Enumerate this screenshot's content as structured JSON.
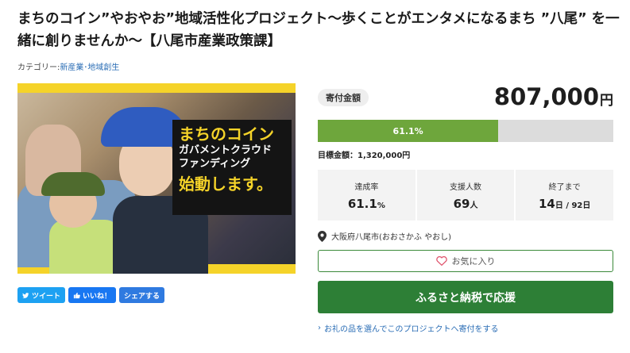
{
  "project": {
    "title": "まちのコイン”やおやお”地域活性化プロジェクト〜歩くことがエンタメになるまち ”八尾” を一緒に創りませんか〜【八尾市産業政策課】",
    "category_label": "カテゴリー:",
    "category_value": "新産業･地域創生"
  },
  "hero": {
    "line1": "まちのコイン",
    "line2": "ガバメントクラウド",
    "line3": "ファンディング",
    "line4": "始動します。"
  },
  "share": {
    "tweet": "ツイート",
    "like": "いいね！",
    "share": "シェアする"
  },
  "funding": {
    "badge": "寄付金額",
    "amount": "807,000",
    "amount_unit": "円",
    "progress_label": "61.1%",
    "progress_fraction": 0.611,
    "target": "目標金額：1,320,000円"
  },
  "stats": [
    {
      "label": "達成率",
      "value": "61.1",
      "suffix": "%"
    },
    {
      "label": "支援人数",
      "value": "69",
      "suffix": "人"
    },
    {
      "label": "終了まで",
      "value": "14",
      "suffix": "日 / 92日"
    }
  ],
  "location": {
    "text": "大阪府八尾市(おおさかふ やおし)"
  },
  "actions": {
    "favorite": "お気に入り",
    "support": "ふるさと納税で応援",
    "gift_link": "お礼の品を選んでこのプロジェクトへ寄付をする"
  },
  "colors": {
    "progress_fill": "#6ea63c",
    "support_button": "#2d7f36",
    "hero_frame": "#f5d329"
  }
}
